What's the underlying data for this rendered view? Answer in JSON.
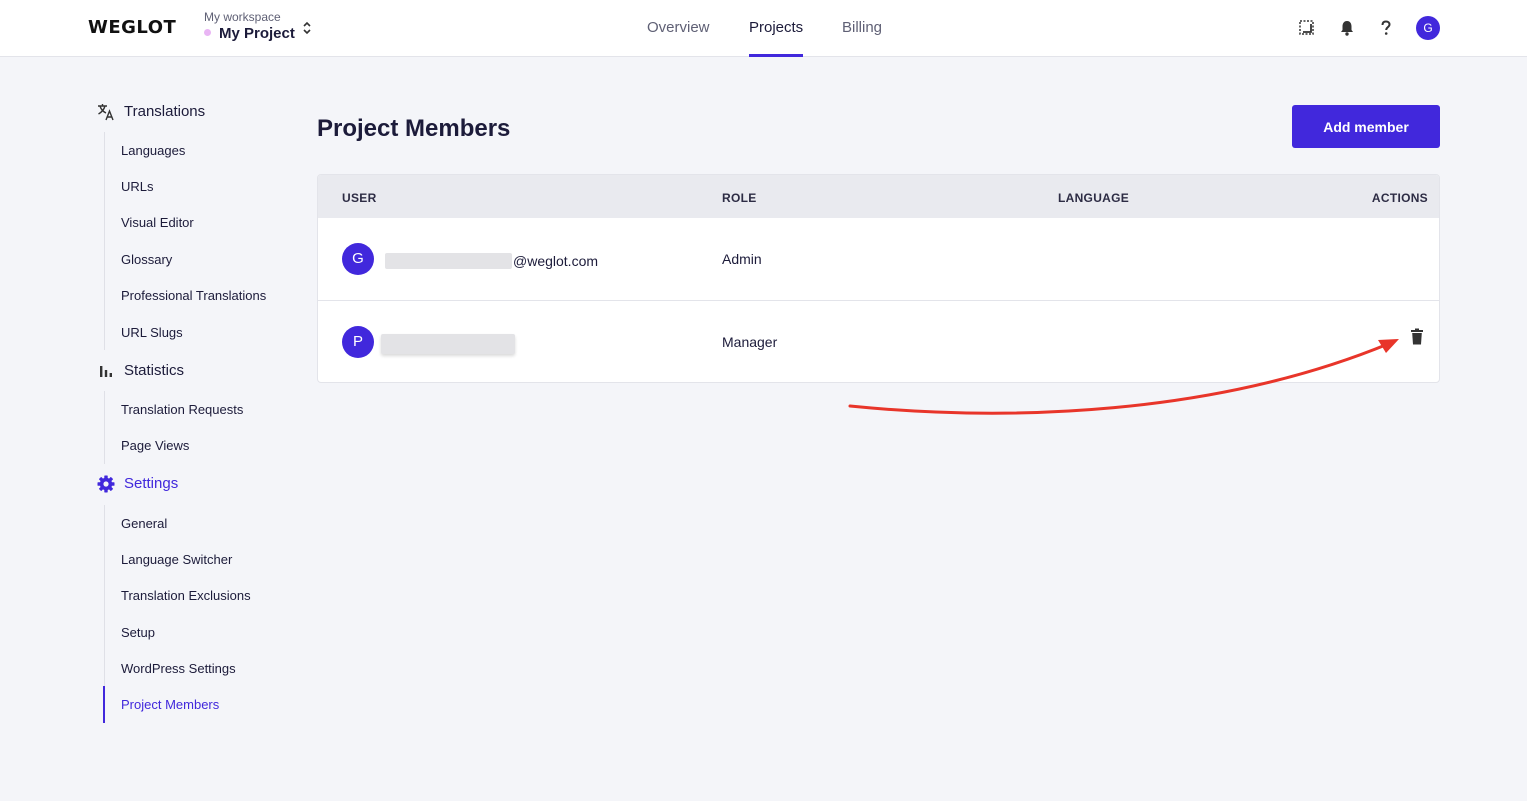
{
  "brand": {
    "logo": "WEGLOT"
  },
  "workspace": {
    "label": "My workspace",
    "project": "My Project"
  },
  "nav": {
    "tabs": [
      "Overview",
      "Projects",
      "Billing"
    ],
    "active": "Projects"
  },
  "user": {
    "avatar_initial": "G"
  },
  "sidebar": {
    "groups": [
      {
        "label": "Translations",
        "icon": "translate-icon",
        "items": [
          "Languages",
          "URLs",
          "Visual Editor",
          "Glossary",
          "Professional Translations",
          "URL Slugs"
        ]
      },
      {
        "label": "Statistics",
        "icon": "bar-chart-icon",
        "items": [
          "Translation Requests",
          "Page Views"
        ]
      },
      {
        "label": "Settings",
        "icon": "gear-icon",
        "items": [
          "General",
          "Language Switcher",
          "Translation Exclusions",
          "Setup",
          "WordPress Settings",
          "Project Members"
        ]
      }
    ],
    "active_item": "Project Members"
  },
  "page": {
    "title": "Project Members",
    "add_button": "Add member"
  },
  "table": {
    "columns": [
      "USER",
      "ROLE",
      "LANGUAGE",
      "ACTIONS"
    ],
    "rows": [
      {
        "initial": "G",
        "email_suffix": "@weglot.com",
        "role": "Admin"
      },
      {
        "initial": "P",
        "email_suffix": "",
        "role": "Manager"
      }
    ]
  },
  "colors": {
    "accent": "#4128dc",
    "annotation_arrow": "#e8352a",
    "background": "#f4f5f9"
  }
}
